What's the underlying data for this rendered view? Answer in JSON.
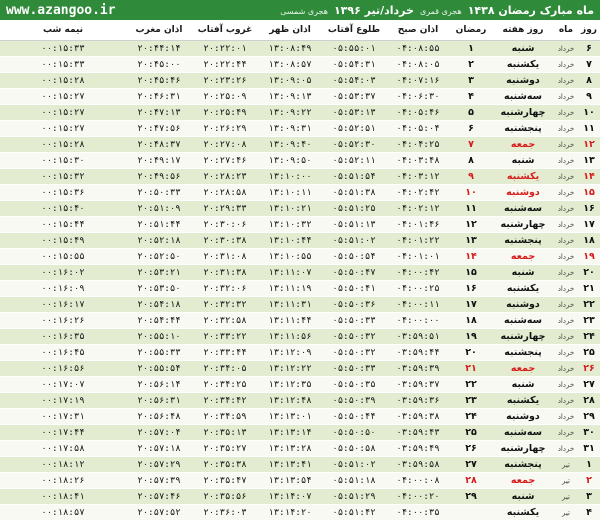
{
  "header": {
    "site": "www.azangoo.ir",
    "title_main": "ماه مبارک رمضان ۱۴۳۸",
    "title_main_sub": "هجری قمری",
    "title_second": "خرداد/تیر ۱۳۹۶",
    "title_second_sub": "هجری شمسی"
  },
  "columns": [
    "روز",
    "ماه",
    "روز هفته",
    "رمضان",
    "اذان صبح",
    "طلوع آفتاب",
    "اذان ظهر",
    "غروب آفتاب",
    "اذان مغرب",
    "نیمه شب"
  ],
  "accent_color": "#2f8a3a",
  "holiday_color": "#d81b1b",
  "rows": [
    {
      "day": "۶",
      "month": "خرداد",
      "weekday": "شنبه",
      "ramadan": "۱",
      "fajr": "۰۴:۰۸:۵۵",
      "sunrise": "۰۵:۵۵:۰۱",
      "dhuhr": "۱۳:۰۸:۴۹",
      "sunset": "۲۰:۲۲:۰۱",
      "maghrib": "۲۰:۴۴:۱۴",
      "midnight": "۰۰:۱۵:۳۳",
      "holiday": false
    },
    {
      "day": "۷",
      "month": "خرداد",
      "weekday": "یکشنبه",
      "ramadan": "۲",
      "fajr": "۰۴:۰۸:۰۵",
      "sunrise": "۰۵:۵۴:۳۱",
      "dhuhr": "۱۳:۰۸:۵۷",
      "sunset": "۲۰:۲۲:۴۴",
      "maghrib": "۲۰:۴۵:۰۰",
      "midnight": "۰۰:۱۵:۳۳",
      "holiday": false
    },
    {
      "day": "۸",
      "month": "خرداد",
      "weekday": "دوشنبه",
      "ramadan": "۳",
      "fajr": "۰۴:۰۷:۱۶",
      "sunrise": "۰۵:۵۴:۰۳",
      "dhuhr": "۱۳:۰۹:۰۵",
      "sunset": "۲۰:۲۳:۲۶",
      "maghrib": "۲۰:۴۵:۴۶",
      "midnight": "۰۰:۱۵:۲۸",
      "holiday": false
    },
    {
      "day": "۹",
      "month": "خرداد",
      "weekday": "سه‌شنبه",
      "ramadan": "۴",
      "fajr": "۰۴:۰۶:۳۰",
      "sunrise": "۰۵:۵۳:۳۷",
      "dhuhr": "۱۳:۰۹:۱۳",
      "sunset": "۲۰:۲۵:۰۹",
      "maghrib": "۲۰:۴۶:۳۱",
      "midnight": "۰۰:۱۵:۲۷",
      "holiday": false
    },
    {
      "day": "۱۰",
      "month": "خرداد",
      "weekday": "چهارشنبه",
      "ramadan": "۵",
      "fajr": "۰۴:۰۵:۴۶",
      "sunrise": "۰۵:۵۳:۱۳",
      "dhuhr": "۱۳:۰۹:۲۲",
      "sunset": "۲۰:۲۵:۴۹",
      "maghrib": "۲۰:۴۷:۱۳",
      "midnight": "۰۰:۱۵:۲۷",
      "holiday": false
    },
    {
      "day": "۱۱",
      "month": "خرداد",
      "weekday": "پنجشنبه",
      "ramadan": "۶",
      "fajr": "۰۴:۰۵:۰۴",
      "sunrise": "۰۵:۵۲:۵۱",
      "dhuhr": "۱۳:۰۹:۳۱",
      "sunset": "۲۰:۲۶:۲۹",
      "maghrib": "۲۰:۴۷:۵۶",
      "midnight": "۰۰:۱۵:۲۷",
      "holiday": false
    },
    {
      "day": "۱۲",
      "month": "خرداد",
      "weekday": "جمعه",
      "ramadan": "۷",
      "fajr": "۰۴:۰۴:۲۵",
      "sunrise": "۰۵:۵۲:۳۰",
      "dhuhr": "۱۳:۰۹:۴۰",
      "sunset": "۲۰:۲۷:۰۸",
      "maghrib": "۲۰:۴۸:۳۷",
      "midnight": "۰۰:۱۵:۲۸",
      "holiday": true
    },
    {
      "day": "۱۳",
      "month": "خرداد",
      "weekday": "شنبه",
      "ramadan": "۸",
      "fajr": "۰۴:۰۳:۴۸",
      "sunrise": "۰۵:۵۲:۱۱",
      "dhuhr": "۱۳:۰۹:۵۰",
      "sunset": "۲۰:۲۷:۴۶",
      "maghrib": "۲۰:۴۹:۱۷",
      "midnight": "۰۰:۱۵:۳۰",
      "holiday": false
    },
    {
      "day": "۱۴",
      "month": "خرداد",
      "weekday": "یکشنبه",
      "ramadan": "۹",
      "fajr": "۰۴:۰۳:۱۲",
      "sunrise": "۰۵:۵۱:۵۴",
      "dhuhr": "۱۳:۱۰:۰۰",
      "sunset": "۲۰:۲۸:۲۳",
      "maghrib": "۲۰:۴۹:۵۶",
      "midnight": "۰۰:۱۵:۳۲",
      "holiday": true
    },
    {
      "day": "۱۵",
      "month": "خرداد",
      "weekday": "دوشنبه",
      "ramadan": "۱۰",
      "fajr": "۰۴:۰۲:۴۲",
      "sunrise": "۰۵:۵۱:۳۸",
      "dhuhr": "۱۳:۱۰:۱۱",
      "sunset": "۲۰:۲۸:۵۸",
      "maghrib": "۲۰:۵۰:۳۳",
      "midnight": "۰۰:۱۵:۳۶",
      "holiday": true
    },
    {
      "day": "۱۶",
      "month": "خرداد",
      "weekday": "سه‌شنبه",
      "ramadan": "۱۱",
      "fajr": "۰۴:۰۲:۱۲",
      "sunrise": "۰۵:۵۱:۲۵",
      "dhuhr": "۱۳:۱۰:۲۱",
      "sunset": "۲۰:۲۹:۳۳",
      "maghrib": "۲۰:۵۱:۰۹",
      "midnight": "۰۰:۱۵:۴۰",
      "holiday": false
    },
    {
      "day": "۱۷",
      "month": "خرداد",
      "weekday": "چهارشنبه",
      "ramadan": "۱۲",
      "fajr": "۰۴:۰۱:۴۶",
      "sunrise": "۰۵:۵۱:۱۳",
      "dhuhr": "۱۳:۱۰:۳۲",
      "sunset": "۲۰:۳۰:۰۶",
      "maghrib": "۲۰:۵۱:۴۴",
      "midnight": "۰۰:۱۵:۴۴",
      "holiday": false
    },
    {
      "day": "۱۸",
      "month": "خرداد",
      "weekday": "پنجشنبه",
      "ramadan": "۱۳",
      "fajr": "۰۴:۰۱:۲۲",
      "sunrise": "۰۵:۵۱:۰۲",
      "dhuhr": "۱۳:۱۰:۴۴",
      "sunset": "۲۰:۳۰:۳۸",
      "maghrib": "۲۰:۵۲:۱۸",
      "midnight": "۰۰:۱۵:۴۹",
      "holiday": false
    },
    {
      "day": "۱۹",
      "month": "خرداد",
      "weekday": "جمعه",
      "ramadan": "۱۴",
      "fajr": "۰۴:۰۱:۰۱",
      "sunrise": "۰۵:۵۰:۵۴",
      "dhuhr": "۱۳:۱۰:۵۵",
      "sunset": "۲۰:۳۱:۰۸",
      "maghrib": "۲۰:۵۲:۵۰",
      "midnight": "۰۰:۱۵:۵۵",
      "holiday": true
    },
    {
      "day": "۲۰",
      "month": "خرداد",
      "weekday": "شنبه",
      "ramadan": "۱۵",
      "fajr": "۰۴:۰۰:۴۲",
      "sunrise": "۰۵:۵۰:۴۷",
      "dhuhr": "۱۳:۱۱:۰۷",
      "sunset": "۲۰:۳۱:۳۸",
      "maghrib": "۲۰:۵۳:۲۱",
      "midnight": "۰۰:۱۶:۰۲",
      "holiday": false
    },
    {
      "day": "۲۱",
      "month": "خرداد",
      "weekday": "یکشنبه",
      "ramadan": "۱۶",
      "fajr": "۰۴:۰۰:۲۵",
      "sunrise": "۰۵:۵۰:۴۱",
      "dhuhr": "۱۳:۱۱:۱۹",
      "sunset": "۲۰:۳۲:۰۶",
      "maghrib": "۲۰:۵۳:۵۰",
      "midnight": "۰۰:۱۶:۰۹",
      "holiday": false
    },
    {
      "day": "۲۲",
      "month": "خرداد",
      "weekday": "دوشنبه",
      "ramadan": "۱۷",
      "fajr": "۰۴:۰۰:۱۱",
      "sunrise": "۰۵:۵۰:۳۶",
      "dhuhr": "۱۳:۱۱:۳۱",
      "sunset": "۲۰:۳۲:۳۲",
      "maghrib": "۲۰:۵۴:۱۸",
      "midnight": "۰۰:۱۶:۱۷",
      "holiday": false
    },
    {
      "day": "۲۳",
      "month": "خرداد",
      "weekday": "سه‌شنبه",
      "ramadan": "۱۸",
      "fajr": "۰۴:۰۰:۰۰",
      "sunrise": "۰۵:۵۰:۳۳",
      "dhuhr": "۱۳:۱۱:۴۴",
      "sunset": "۲۰:۳۲:۵۸",
      "maghrib": "۲۰:۵۴:۴۴",
      "midnight": "۰۰:۱۶:۲۶",
      "holiday": false
    },
    {
      "day": "۲۴",
      "month": "خرداد",
      "weekday": "چهارشنبه",
      "ramadan": "۱۹",
      "fajr": "۰۳:۵۹:۵۱",
      "sunrise": "۰۵:۵۰:۳۲",
      "dhuhr": "۱۳:۱۱:۵۶",
      "sunset": "۲۰:۳۳:۲۲",
      "maghrib": "۲۰:۵۵:۱۰",
      "midnight": "۰۰:۱۶:۳۵",
      "holiday": false
    },
    {
      "day": "۲۵",
      "month": "خرداد",
      "weekday": "پنجشنبه",
      "ramadan": "۲۰",
      "fajr": "۰۳:۵۹:۴۴",
      "sunrise": "۰۵:۵۰:۳۲",
      "dhuhr": "۱۳:۱۲:۰۹",
      "sunset": "۲۰:۳۳:۴۴",
      "maghrib": "۲۰:۵۵:۳۳",
      "midnight": "۰۰:۱۶:۴۵",
      "holiday": false
    },
    {
      "day": "۲۶",
      "month": "خرداد",
      "weekday": "جمعه",
      "ramadan": "۲۱",
      "fajr": "۰۳:۵۹:۳۹",
      "sunrise": "۰۵:۵۰:۳۳",
      "dhuhr": "۱۳:۱۲:۲۲",
      "sunset": "۲۰:۳۴:۰۵",
      "maghrib": "۲۰:۵۵:۵۴",
      "midnight": "۰۰:۱۶:۵۶",
      "holiday": true
    },
    {
      "day": "۲۷",
      "month": "خرداد",
      "weekday": "شنبه",
      "ramadan": "۲۲",
      "fajr": "۰۳:۵۹:۳۷",
      "sunrise": "۰۵:۵۰:۳۵",
      "dhuhr": "۱۳:۱۲:۳۵",
      "sunset": "۲۰:۳۴:۲۵",
      "maghrib": "۲۰:۵۶:۱۴",
      "midnight": "۰۰:۱۷:۰۷",
      "holiday": false
    },
    {
      "day": "۲۸",
      "month": "خرداد",
      "weekday": "یکشنبه",
      "ramadan": "۲۳",
      "fajr": "۰۳:۵۹:۳۶",
      "sunrise": "۰۵:۵۰:۳۹",
      "dhuhr": "۱۳:۱۲:۴۸",
      "sunset": "۲۰:۳۴:۴۲",
      "maghrib": "۲۰:۵۶:۳۱",
      "midnight": "۰۰:۱۷:۱۹",
      "holiday": false
    },
    {
      "day": "۲۹",
      "month": "خرداد",
      "weekday": "دوشنبه",
      "ramadan": "۲۴",
      "fajr": "۰۳:۵۹:۳۸",
      "sunrise": "۰۵:۵۰:۴۴",
      "dhuhr": "۱۳:۱۳:۰۱",
      "sunset": "۲۰:۳۴:۵۹",
      "maghrib": "۲۰:۵۶:۴۸",
      "midnight": "۰۰:۱۷:۳۱",
      "holiday": false
    },
    {
      "day": "۳۰",
      "month": "خرداد",
      "weekday": "سه‌شنبه",
      "ramadan": "۲۵",
      "fajr": "۰۳:۵۹:۴۳",
      "sunrise": "۰۵:۵۰:۵۰",
      "dhuhr": "۱۳:۱۳:۱۴",
      "sunset": "۲۰:۳۵:۱۳",
      "maghrib": "۲۰:۵۷:۰۴",
      "midnight": "۰۰:۱۷:۴۴",
      "holiday": false
    },
    {
      "day": "۳۱",
      "month": "خرداد",
      "weekday": "چهارشنبه",
      "ramadan": "۲۶",
      "fajr": "۰۳:۵۹:۴۹",
      "sunrise": "۰۵:۵۰:۵۸",
      "dhuhr": "۱۳:۱۳:۲۸",
      "sunset": "۲۰:۳۵:۲۷",
      "maghrib": "۲۰:۵۷:۱۸",
      "midnight": "۰۰:۱۷:۵۸",
      "holiday": false
    },
    {
      "day": "۱",
      "month": "تیر",
      "weekday": "پنجشنبه",
      "ramadan": "۲۷",
      "fajr": "۰۳:۵۹:۵۸",
      "sunrise": "۰۵:۵۱:۰۲",
      "dhuhr": "۱۳:۱۳:۴۱",
      "sunset": "۲۰:۳۵:۳۸",
      "maghrib": "۲۰:۵۷:۲۹",
      "midnight": "۰۰:۱۸:۱۲",
      "holiday": false
    },
    {
      "day": "۲",
      "month": "تیر",
      "weekday": "جمعه",
      "ramadan": "۲۸",
      "fajr": "۰۴:۰۰:۰۸",
      "sunrise": "۰۵:۵۱:۱۸",
      "dhuhr": "۱۳:۱۳:۵۴",
      "sunset": "۲۰:۳۵:۴۷",
      "maghrib": "۲۰:۵۷:۳۹",
      "midnight": "۰۰:۱۸:۲۶",
      "holiday": true
    },
    {
      "day": "۳",
      "month": "تیر",
      "weekday": "شنبه",
      "ramadan": "۲۹",
      "fajr": "۰۴:۰۰:۲۰",
      "sunrise": "۰۵:۵۱:۲۹",
      "dhuhr": "۱۳:۱۴:۰۷",
      "sunset": "۲۰:۳۵:۵۶",
      "maghrib": "۲۰:۵۷:۴۶",
      "midnight": "۰۰:۱۸:۴۱",
      "holiday": false
    },
    {
      "day": "۴",
      "month": "تیر",
      "weekday": "یکشنبه",
      "ramadan": "",
      "fajr": "۰۴:۰۰:۳۵",
      "sunrise": "۰۵:۵۱:۴۲",
      "dhuhr": "۱۳:۱۴:۲۰",
      "sunset": "۲۰:۳۶:۰۳",
      "maghrib": "۲۰:۵۷:۵۲",
      "midnight": "۰۰:۱۸:۵۷",
      "holiday": false
    }
  ]
}
